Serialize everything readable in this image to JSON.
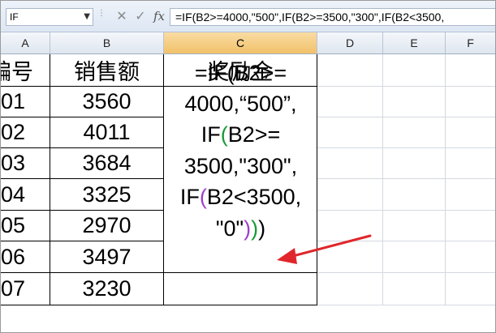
{
  "formula_bar": {
    "name_box": "IF",
    "name_box_arrow": "▼",
    "splitter": "⋮",
    "cancel_glyph": "✕",
    "enter_glyph": "✓",
    "fx_glyph": "fx",
    "formula": "=IF(B2>=4000,\"500\",IF(B2>=3500,\"300\",IF(B2<3500,"
  },
  "columns": [
    "A",
    "B",
    "C",
    "D",
    "E",
    "F"
  ],
  "active_column": "C",
  "headers": {
    "a": "编号",
    "b": "销售额",
    "c": "奖励金"
  },
  "rows": [
    {
      "a": "01",
      "b": "3560"
    },
    {
      "a": "02",
      "b": "4011"
    },
    {
      "a": "03",
      "b": "3684"
    },
    {
      "a": "04",
      "b": "3325"
    },
    {
      "a": "05",
      "b": "2970"
    },
    {
      "a": "06",
      "b": "3497"
    },
    {
      "a": "07",
      "b": "3230"
    }
  ],
  "c2_formula_lines": {
    "line1": "=IF(B2>=",
    "line2": "4000,“500”,",
    "line3_a": "IF",
    "line3_paren": "(",
    "line3_b": "B2>=",
    "line4": "3500,\"300\",",
    "line5_a": "IF",
    "line5_paren": "(",
    "line5_b": "B2<3500,",
    "line6_a": "\"0\"",
    "line6_p1": ")",
    "line6_p2": ")",
    "line6_p3": ")"
  },
  "colors": {
    "paren_green": "#1a9a3a",
    "paren_purple": "#a040c8",
    "arrow_red": "#e0262b",
    "active_header": "#f2c26b"
  }
}
